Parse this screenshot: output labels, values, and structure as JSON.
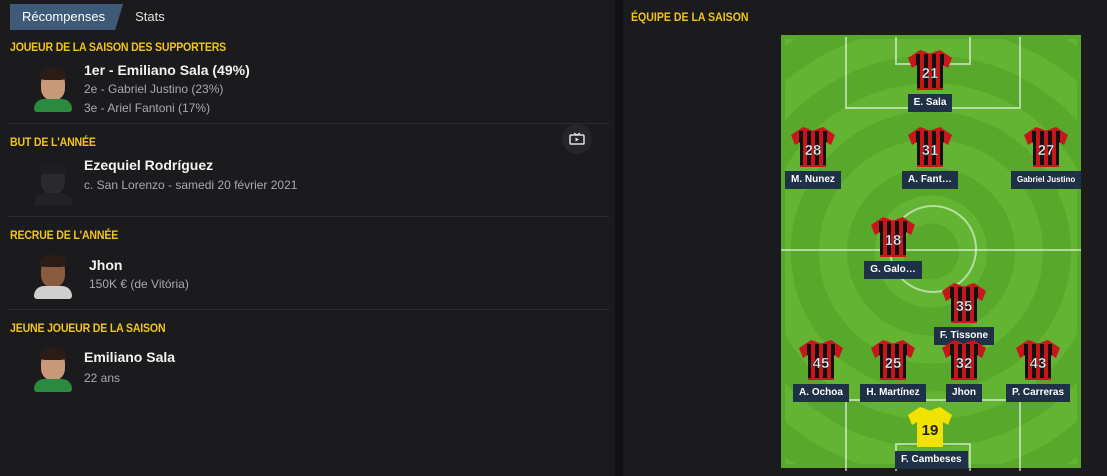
{
  "tabs": [
    {
      "label": "Récompenses",
      "active": true
    },
    {
      "label": "Stats",
      "active": false
    }
  ],
  "awards": {
    "supporters": {
      "title": "JOUEUR DE LA SAISON DES SUPPORTERS",
      "first": "1er - Emiliano Sala (49%)",
      "second": "2e - Gabriel Justino (23%)",
      "third": "3e - Ariel Fantoni (17%)"
    },
    "goal": {
      "title": "BUT DE L'ANNÉE",
      "name": "Ezequiel Rodríguez",
      "detail": "c. San Lorenzo - samedi 20 février 2021",
      "icon": "tv-icon"
    },
    "signing": {
      "title": "RECRUE DE L'ANNÉE",
      "name": "Jhon",
      "detail": "150K € (de Vitória)"
    },
    "young": {
      "title": "JEUNE JOUEUR DE LA SAISON",
      "name": "Emiliano Sala",
      "detail": "22 ans"
    }
  },
  "team": {
    "title": "ÉQUIPE DE LA SAISON",
    "players": [
      {
        "number": "21",
        "name": "E. Sala",
        "kit": "striped"
      },
      {
        "number": "28",
        "name": "M. Nunez",
        "kit": "striped"
      },
      {
        "number": "31",
        "name": "A. Fant…",
        "kit": "striped"
      },
      {
        "number": "27",
        "name": "Gabriel Justino",
        "kit": "striped"
      },
      {
        "number": "18",
        "name": "G. Galo…",
        "kit": "striped"
      },
      {
        "number": "35",
        "name": "F. Tissone",
        "kit": "striped"
      },
      {
        "number": "45",
        "name": "A. Ochoa",
        "kit": "striped"
      },
      {
        "number": "25",
        "name": "H. Martínez",
        "kit": "striped"
      },
      {
        "number": "32",
        "name": "Jhon",
        "kit": "striped"
      },
      {
        "number": "43",
        "name": "P. Carreras",
        "kit": "striped"
      },
      {
        "number": "19",
        "name": "F. Cambeses",
        "kit": "goalkeeper"
      }
    ]
  },
  "colors": {
    "accent": "#f0c419",
    "tab_active": "#3e5a78",
    "kit_red": "#c8161d",
    "kit_black": "#111111",
    "gk_yellow": "#f2e200",
    "pitch": "#58a92b"
  }
}
